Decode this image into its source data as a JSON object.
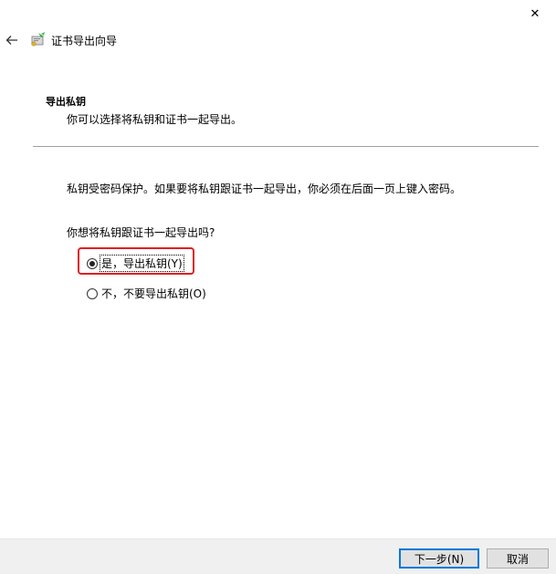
{
  "window": {
    "title": "证书导出向导",
    "close_glyph": "✕",
    "back_glyph": "←"
  },
  "header": {
    "section_title": "导出私钥",
    "section_subtitle": "你可以选择将私钥和证书一起导出。"
  },
  "body": {
    "description": "私钥受密码保护。如果要将私钥跟证书一起导出，你必须在后面一页上键入密码。",
    "question": "你想将私钥跟证书一起导出吗?",
    "options": [
      {
        "label": "是，导出私钥(Y)",
        "selected": true
      },
      {
        "label": "不，不要导出私钥(O)",
        "selected": false
      }
    ]
  },
  "footer": {
    "next_label": "下一步(N)",
    "cancel_label": "取消"
  },
  "colors": {
    "highlight": "#e02020",
    "default_button_border": "#0078d7",
    "footer_bg": "#f0f0f0"
  },
  "icons": {
    "back": "back-arrow-icon",
    "wizard": "certificate-wizard-icon",
    "close": "close-icon"
  }
}
